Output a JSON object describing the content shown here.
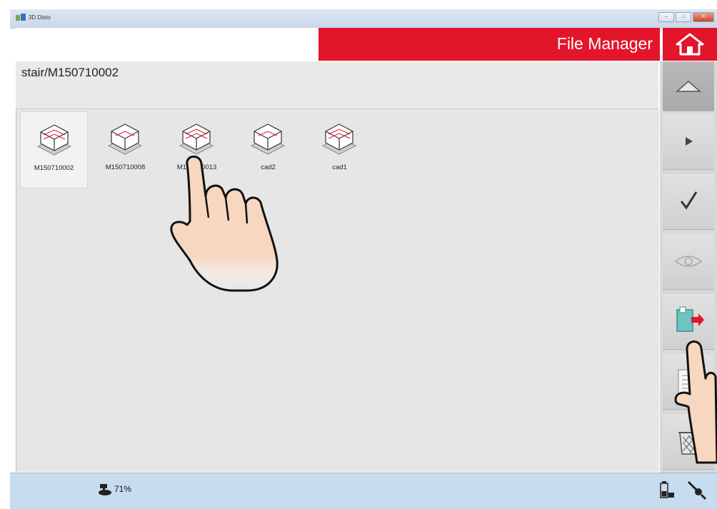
{
  "window": {
    "title": "3D Disto"
  },
  "header": {
    "title": "File Manager"
  },
  "path": {
    "text": "stair/M150710002"
  },
  "files": [
    {
      "name": "M150710002",
      "selected": true
    },
    {
      "name": "M150710008",
      "selected": false
    },
    {
      "name": "M150710013",
      "selected": false
    },
    {
      "name": "cad2",
      "selected": false
    },
    {
      "name": "cad1",
      "selected": false
    }
  ],
  "toolbar": {
    "buttons": [
      "up-icon",
      "play-icon",
      "checkmark-icon",
      "eye-icon",
      "export-icon",
      "report-icon",
      "trash-icon"
    ]
  },
  "status": {
    "battery_percent": "71%"
  },
  "colors": {
    "accent": "#e2152a",
    "status_bar": "#c8dcf0",
    "content_bg": "#e6e6e6"
  }
}
